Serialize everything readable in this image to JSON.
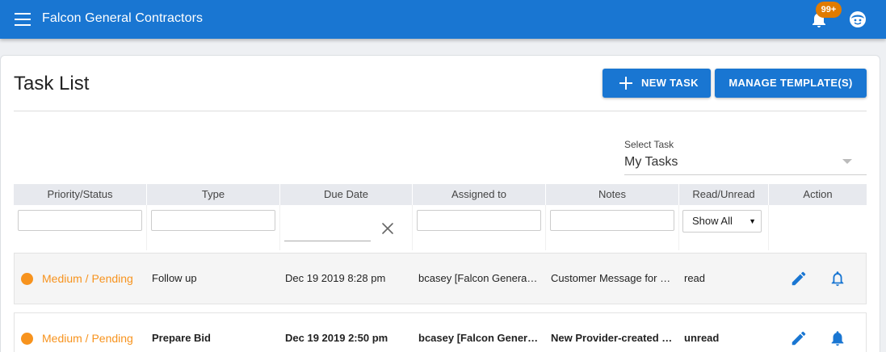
{
  "app": {
    "title": "Falcon General Contractors",
    "notification_count": "99+",
    "brand_color": "#1976d2",
    "badge_color": "#e07b00"
  },
  "page": {
    "title": "Task List",
    "new_task_label": "NEW TASK",
    "manage_templates_label": "MANAGE TEMPLATE(S)"
  },
  "task_select": {
    "label": "Select Task",
    "value": "My Tasks"
  },
  "table": {
    "columns": [
      "Priority/Status",
      "Type",
      "Due Date",
      "Assigned to",
      "Notes",
      "Read/Unread",
      "Action"
    ],
    "read_filter_value": "Show All",
    "rows": [
      {
        "priority_status": "Medium / Pending",
        "type": "Follow up",
        "due_date": "Dec 19 2019 8:28 pm",
        "assigned_to": "bcasey [Falcon General Contractors]",
        "notes": "Customer Message for Service Request",
        "read_status": "read"
      },
      {
        "priority_status": "Medium / Pending",
        "type": "Prepare Bid",
        "due_date": "Dec 19 2019 2:50 pm",
        "assigned_to": "bcasey [Falcon General Contractors]",
        "notes": "New Provider-created Service Request",
        "read_status": "unread"
      }
    ]
  },
  "icons": {
    "menu": "menu-icon",
    "notifications": "bell-icon",
    "account": "account-face-icon",
    "add": "plus-icon",
    "clear": "close-icon",
    "edit": "pencil-icon",
    "reminder": "bell-outline-icon"
  },
  "colors": {
    "priority_medium": "#f7931e",
    "action_icon": "#1976d2"
  }
}
